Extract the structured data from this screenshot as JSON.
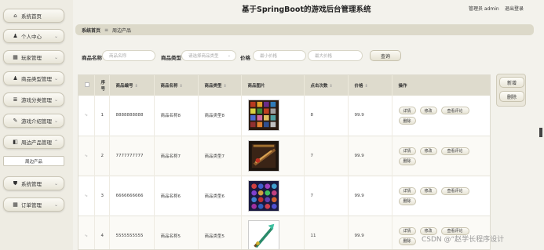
{
  "app_title": "基于SpringBoot的游戏后台管理系统",
  "header": {
    "admin_label": "管理员 admin",
    "logout_label": "退出登录"
  },
  "sidebar": {
    "items": [
      {
        "label": "系统首页",
        "icon": "home-icon",
        "glyph": "⌂",
        "chevron": ""
      },
      {
        "label": "个人中心",
        "icon": "user-icon",
        "glyph": "♟",
        "chevron": "⌄"
      },
      {
        "label": "玩家管理",
        "icon": "grid-icon",
        "glyph": "▦",
        "chevron": "⌄"
      },
      {
        "label": "商品类型管理",
        "icon": "user-icon",
        "glyph": "♟",
        "chevron": "⌄"
      },
      {
        "label": "游戏分类管理",
        "icon": "list-icon",
        "glyph": "≣",
        "chevron": "⌄"
      },
      {
        "label": "游戏介绍管理",
        "icon": "paint-icon",
        "glyph": "✎",
        "chevron": "⌄"
      },
      {
        "label": "周边产品管理",
        "icon": "cube-icon",
        "glyph": "◧",
        "chevron": "⌃"
      },
      {
        "label": "系统管理",
        "icon": "shield-icon",
        "glyph": "⛊",
        "chevron": "⌄"
      },
      {
        "label": "订单管理",
        "icon": "grid-icon",
        "glyph": "▦",
        "chevron": "⌄"
      }
    ],
    "sub_item": "周边产品"
  },
  "breadcrumb": {
    "home": "系统首页",
    "separator": "≡",
    "current": "周边产品"
  },
  "search": {
    "name_label": "商品名称",
    "name_placeholder": "商品名称",
    "type_label": "商品类型",
    "type_placeholder": "请选择商品类型",
    "price_label": "价格",
    "min_price_placeholder": "最小价格",
    "max_price_placeholder": "最大价格",
    "search_button": "查询"
  },
  "actions": {
    "add": "新增",
    "delete": "删除"
  },
  "table": {
    "columns": [
      "",
      "序号",
      "商品编号",
      "商品名称",
      "商品类型",
      "商品图片",
      "点击次数",
      "价格",
      "操作"
    ],
    "rows": [
      {
        "index": "1",
        "code": "8888888888",
        "name": "商品名称8",
        "type": "商品类型8",
        "clicks": "8",
        "price": "99.9"
      },
      {
        "index": "2",
        "code": "7777777777",
        "name": "商品名称7",
        "type": "商品类型7",
        "clicks": "7",
        "price": "99.9"
      },
      {
        "index": "3",
        "code": "6666666666",
        "name": "商品名称6",
        "type": "商品类型6",
        "clicks": "7",
        "price": "99.9"
      },
      {
        "index": "4",
        "code": "5555555555",
        "name": "商品名称5",
        "type": "商品类型5",
        "clicks": "11",
        "price": "99.9"
      }
    ],
    "row_actions": {
      "detail": "详情",
      "edit": "修改",
      "comments": "查看评论",
      "delete": "删除"
    }
  },
  "watermark": "CSDN @“赵学长程序设计"
}
